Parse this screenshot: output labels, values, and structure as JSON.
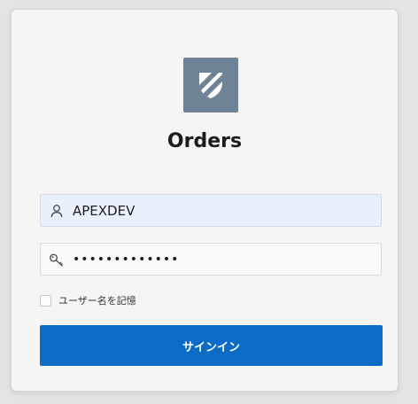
{
  "app": {
    "title": "Orders",
    "logo_icon": "shield-icon",
    "logo_color": "#6f8396"
  },
  "login": {
    "username": {
      "icon": "user-icon",
      "value": "APEXDEV"
    },
    "password": {
      "icon": "key-icon",
      "value": "•••••••••••••"
    },
    "remember_label": "ユーザー名を記憶",
    "remember_checked": false,
    "signin_label": "サインイン",
    "accent_color": "#0b6bc7"
  }
}
